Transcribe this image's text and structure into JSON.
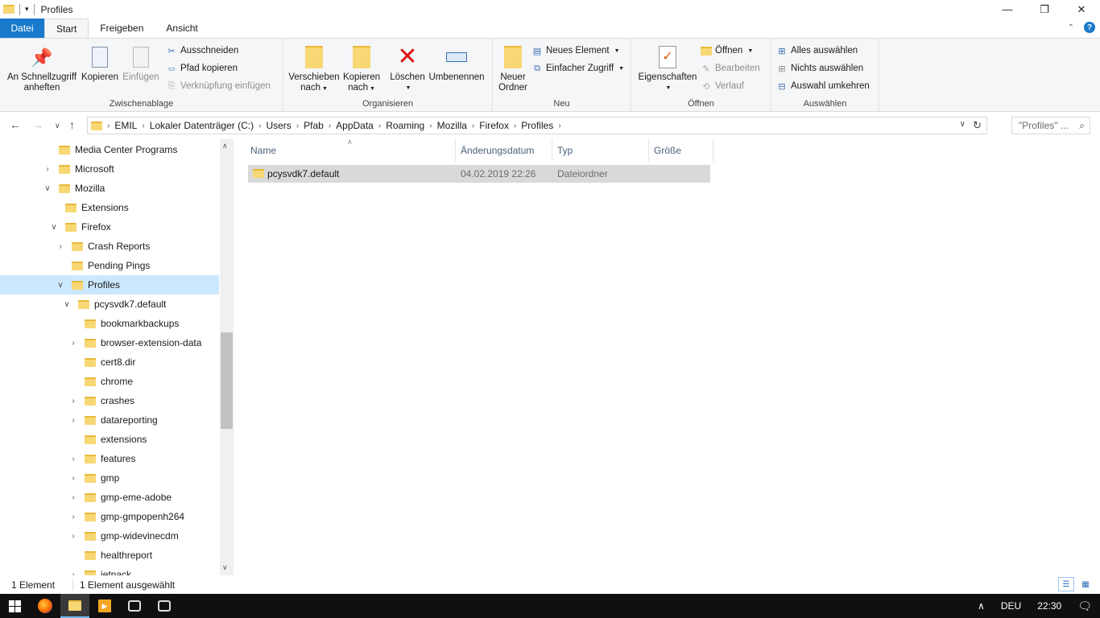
{
  "window": {
    "title": "Profiles"
  },
  "ribbon_tabs": [
    "Datei",
    "Start",
    "Freigeben",
    "Ansicht"
  ],
  "ribbon": {
    "clipboard": {
      "pin_label_1": "An Schnellzugriff",
      "pin_label_2": "anheften",
      "copy": "Kopieren",
      "paste": "Einfügen",
      "cut": "Ausschneiden",
      "copy_path": "Pfad kopieren",
      "paste_shortcut": "Verknüpfung einfügen",
      "group": "Zwischenablage"
    },
    "organize": {
      "move_1": "Verschieben",
      "move_2": "nach",
      "copyto_1": "Kopieren",
      "copyto_2": "nach",
      "delete": "Löschen",
      "rename": "Umbenennen",
      "group": "Organisieren"
    },
    "new": {
      "new_folder_1": "Neuer",
      "new_folder_2": "Ordner",
      "new_item": "Neues Element",
      "easy_access": "Einfacher Zugriff",
      "group": "Neu"
    },
    "open": {
      "properties": "Eigenschaften",
      "open": "Öffnen",
      "edit": "Bearbeiten",
      "history": "Verlauf",
      "group": "Öffnen"
    },
    "select": {
      "select_all": "Alles auswählen",
      "select_none": "Nichts auswählen",
      "invert": "Auswahl umkehren",
      "group": "Auswählen"
    }
  },
  "address": {
    "crumbs": [
      "EMIL",
      "Lokaler Datenträger (C:)",
      "Users",
      "Pfab",
      "AppData",
      "Roaming",
      "Mozilla",
      "Firefox",
      "Profiles"
    ]
  },
  "search": {
    "placeholder": "\"Profiles\" ..."
  },
  "tree": [
    {
      "label": "Media Center Programs"
    },
    {
      "label": "Microsoft"
    },
    {
      "label": "Mozilla"
    },
    {
      "label": "Extensions"
    },
    {
      "label": "Firefox"
    },
    {
      "label": "Crash Reports"
    },
    {
      "label": "Pending Pings"
    },
    {
      "label": "Profiles"
    },
    {
      "label": "pcysvdk7.default"
    },
    {
      "label": "bookmarkbackups"
    },
    {
      "label": "browser-extension-data"
    },
    {
      "label": "cert8.dir"
    },
    {
      "label": "chrome"
    },
    {
      "label": "crashes"
    },
    {
      "label": "datareporting"
    },
    {
      "label": "extensions"
    },
    {
      "label": "features"
    },
    {
      "label": "gmp"
    },
    {
      "label": "gmp-eme-adobe"
    },
    {
      "label": "gmp-gmpopenh264"
    },
    {
      "label": "gmp-widevinecdm"
    },
    {
      "label": "healthreport"
    },
    {
      "label": "jetpack"
    }
  ],
  "columns": {
    "name": "Name",
    "date": "Änderungsdatum",
    "type": "Typ",
    "size": "Größe"
  },
  "files": [
    {
      "name": "pcysvdk7.default",
      "date": "04.02.2019 22:26",
      "type": "Dateiordner",
      "size": ""
    }
  ],
  "status": {
    "count": "1 Element",
    "selected": "1 Element ausgewählt"
  },
  "taskbar": {
    "lang": "DEU",
    "time": "22:30"
  },
  "colors": {
    "accent": "#1979ca",
    "selection": "#cce8ff",
    "folder": "#f8d775"
  }
}
